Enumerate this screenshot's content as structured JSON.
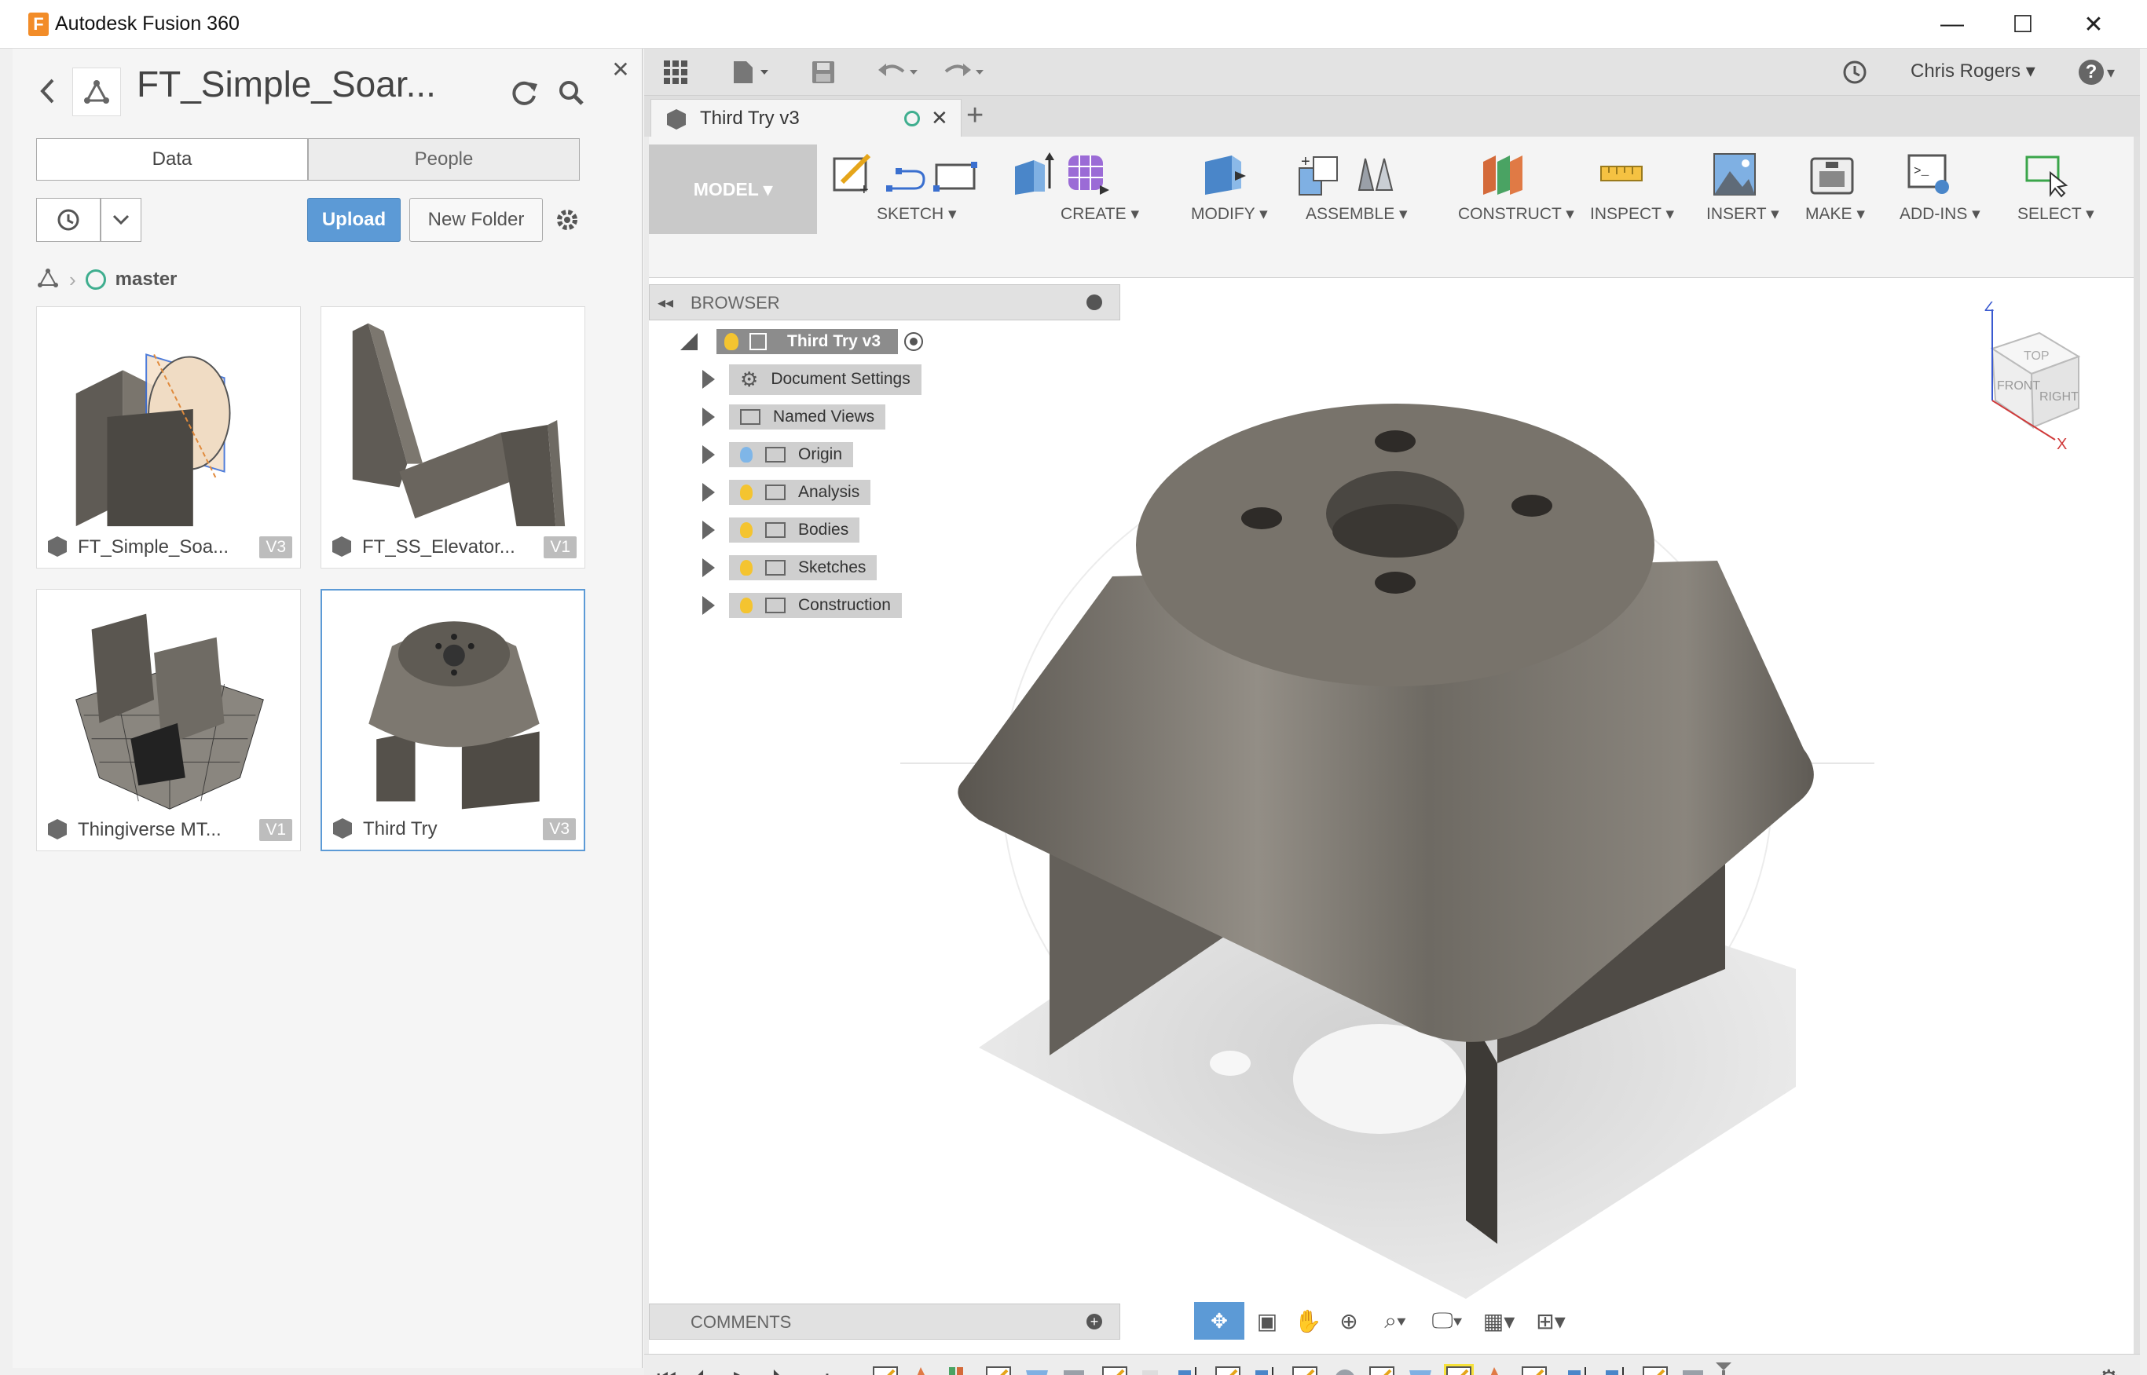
{
  "window": {
    "title": "Autodesk Fusion 360",
    "minimize_glyph": "—",
    "maximize_glyph": "☐",
    "close_glyph": "✕"
  },
  "data_panel": {
    "project_title": "FT_Simple_Soar...",
    "tabs": [
      {
        "label": "Data",
        "active": true
      },
      {
        "label": "People",
        "active": false
      }
    ],
    "upload_label": "Upload",
    "new_folder_label": "New Folder",
    "breadcrumb_branch": "master",
    "files": [
      {
        "name": "FT_Simple_Soa...",
        "version": "V3"
      },
      {
        "name": "FT_SS_Elevator...",
        "version": "V1"
      },
      {
        "name": "Thingiverse MT...",
        "version": "V1"
      },
      {
        "name": "Third Try",
        "version": "V3"
      }
    ]
  },
  "toolbar": {
    "user_name": "Chris Rogers",
    "user_caret": "▾",
    "help_glyph": "?"
  },
  "document_tab": {
    "label": "Third Try v3",
    "close_glyph": "✕",
    "new_tab_glyph": "+"
  },
  "ribbon": {
    "workspace": "MODEL ▾",
    "groups": [
      "SKETCH ▾",
      "CREATE ▾",
      "MODIFY ▾",
      "ASSEMBLE ▾",
      "CONSTRUCT ▾",
      "INSPECT ▾",
      "INSERT ▾",
      "MAKE ▾",
      "ADD-INS ▾",
      "SELECT ▾"
    ]
  },
  "browser": {
    "title": "BROWSER",
    "root": "Third Try v3",
    "items": [
      "Document Settings",
      "Named Views",
      "Origin",
      "Analysis",
      "Bodies",
      "Sketches",
      "Construction"
    ]
  },
  "comments": {
    "title": "COMMENTS"
  },
  "viewcube": {
    "top": "TOP",
    "front": "FRONT",
    "right": "RIGHT",
    "axis_z": "Z",
    "axis_x": "X"
  },
  "colors": {
    "accent": "#5c9ad6",
    "model_gray": "#6f6b64",
    "bulb_yellow": "#f4c430",
    "bulb_blue": "#7fb6e8"
  }
}
